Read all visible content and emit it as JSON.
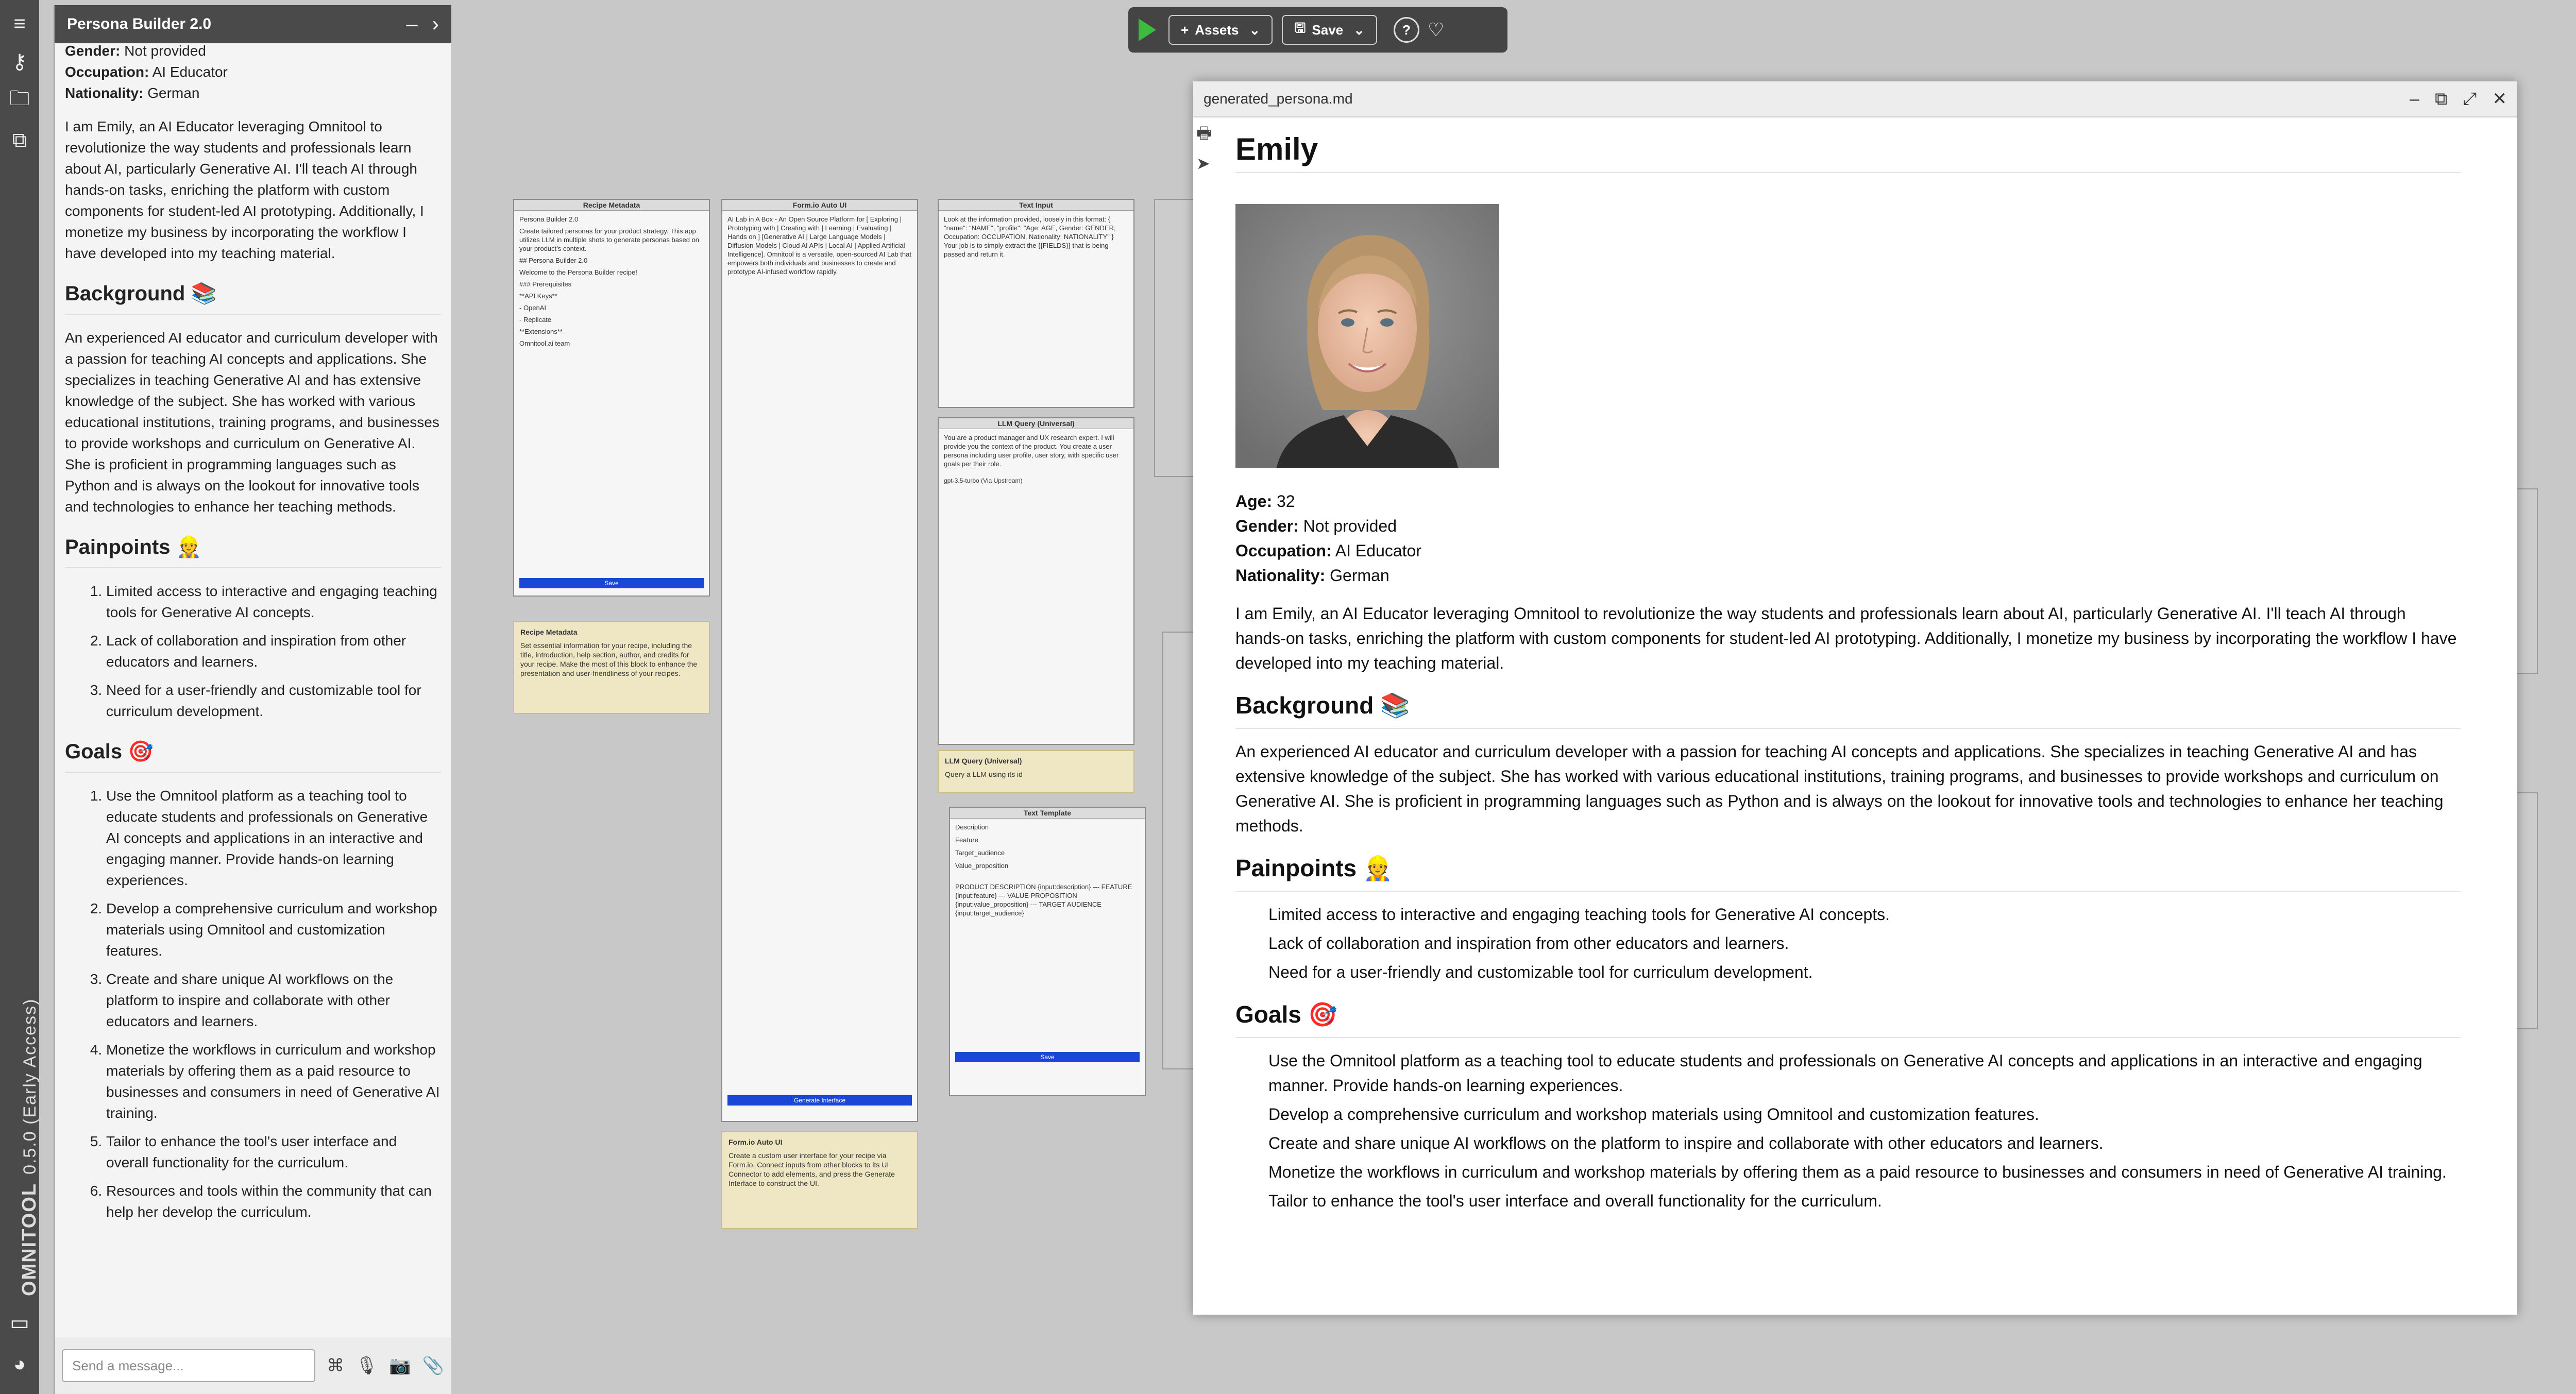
{
  "app": {
    "name": "OMNITOOL",
    "version": "0.5.0 (Early Access)"
  },
  "rail": {
    "icons": [
      "menu-icon",
      "key-icon",
      "folder-icon",
      "extensions-icon"
    ],
    "bottom_icons": [
      "chat-icon",
      "discord-icon"
    ]
  },
  "chat": {
    "title": "Persona Builder 2.0",
    "facts": [
      {
        "label": "Gender:",
        "value": "Not provided"
      },
      {
        "label": "Occupation:",
        "value": "AI Educator"
      },
      {
        "label": "Nationality:",
        "value": "German"
      }
    ],
    "intro": "I am Emily, an AI Educator leveraging Omnitool to revolutionize the way students and professionals learn about AI, particularly Generative AI. I'll teach AI through hands-on tasks, enriching the platform with custom components for student-led AI prototyping. Additionally, I monetize my business by incorporating the workflow I have developed into my teaching material.",
    "background_heading": "Background 📚",
    "background": "An experienced AI educator and curriculum developer with a passion for teaching AI concepts and applications. She specializes in teaching Generative AI and has extensive knowledge of the subject. She has worked with various educational institutions, training programs, and businesses to provide workshops and curriculum on Generative AI. She is proficient in programming languages such as Python and is always on the lookout for innovative tools and technologies to enhance her teaching methods.",
    "painpoints_heading": "Painpoints 👷",
    "painpoints": [
      "Limited access to interactive and engaging teaching tools for Generative AI concepts.",
      "Lack of collaboration and inspiration from other educators and learners.",
      "Need for a user-friendly and customizable tool for curriculum development."
    ],
    "goals_heading": "Goals 🎯",
    "goals": [
      "Use the Omnitool platform as a teaching tool to educate students and professionals on Generative AI concepts and applications in an interactive and engaging manner. Provide hands-on learning experiences.",
      "Develop a comprehensive curriculum and workshop materials using Omnitool and customization features.",
      "Create and share unique AI workflows on the platform to inspire and collaborate with other educators and learners.",
      "Monetize the workflows in curriculum and workshop materials by offering them as a paid resource to businesses and consumers in need of Generative AI training.",
      "Tailor to enhance the tool's user interface and overall functionality for the curriculum.",
      "Resources and tools within the community that can help her develop the curriculum."
    ],
    "input_placeholder": "Send a message..."
  },
  "toolbar": {
    "assets_label": "Assets",
    "save_label": "Save",
    "help": "?",
    "favorite": "♡"
  },
  "nodes": {
    "recipe_metadata": {
      "title": "Recipe Metadata",
      "lines": [
        "Persona Builder 2.0",
        "Create tailored personas for your product strategy. This app utilizes LLM in multiple shots to generate personas based on your product's context.",
        "## Persona Builder 2.0",
        "Welcome to the Persona Builder recipe!",
        "### Prerequisites",
        "**API Keys**",
        "- OpenAI",
        "- Replicate",
        "**Extensions**",
        "Omnitool.ai team"
      ],
      "save": "Save"
    },
    "recipe_note": {
      "title": "Recipe Metadata",
      "text": "Set essential information for your recipe, including the title, introduction, help section, author, and credits for your recipe. Make the most of this block to enhance the presentation and user-friendliness of your recipes."
    },
    "form_auto_ui": {
      "title": "Form.io Auto UI",
      "text": "AI Lab in A Box - An Open Source Platform for [ Exploring | Prototyping with | Creating with | Learning | Evaluating | Hands on ] [Generative AI | Large Language Models | Diffusion Models | Cloud AI APIs | Local AI | Applied Artificial Intelligence]. Omnitool is a versatile, open-sourced AI Lab that empowers both individuals and businesses to create and prototype AI-infused workflow rapidly.",
      "button": "Generate Interface"
    },
    "form_note": {
      "title": "Form.io Auto UI",
      "text": "Create a custom user interface for your recipe via Form.io. Connect inputs from other blocks to its UI Connector to add elements, and press the Generate Interface to construct the UI."
    },
    "text_input": {
      "title": "Text Input",
      "text": "Look at the information provided, loosely in this format: { \"name\": \"NAME\", \"profile\": \"Age: AGE, Gender: GENDER, Occupation: OCCUPATION, Nationality: NATIONALITY\" } Your job is to simply extract the {{FIELDS}} that is being passed and return it."
    },
    "llm_query": {
      "title": "LLM Query (Universal)",
      "text": "You are a product manager and UX research expert. I will provide you the context of the product. You create a user persona including user profile, user story, with specific user goals per their role.",
      "model": "gpt-3.5-turbo (Via Upstream)"
    },
    "llm_note": {
      "title": "LLM Query (Universal)",
      "text": "Query a LLM using its id"
    },
    "text_template": {
      "title": "Text Template",
      "fields": [
        "Description",
        "Feature",
        "Target_audience",
        "Value_proposition"
      ],
      "template": "PRODUCT DESCRIPTION {input:description} --- FEATURE {input:feature} --- VALUE PROPOSITION {input:value_proposition} --- TARGET AUDIENCE {input:target_audience}",
      "save": "Save"
    }
  },
  "document": {
    "filename": "generated_persona.md",
    "title": "Emily",
    "facts": [
      {
        "label": "Age:",
        "value": "32"
      },
      {
        "label": "Gender:",
        "value": "Not provided"
      },
      {
        "label": "Occupation:",
        "value": "AI Educator"
      },
      {
        "label": "Nationality:",
        "value": "German"
      }
    ],
    "intro": "I am Emily, an AI Educator leveraging Omnitool to revolutionize the way students and professionals learn about AI, particularly Generative AI. I'll teach AI through hands-on tasks, enriching the platform with custom components for student-led AI prototyping. Additionally, I monetize my business by incorporating the workflow I have developed into my teaching material.",
    "background_heading": "Background 📚",
    "background": "An experienced AI educator and curriculum developer with a passion for teaching AI concepts and applications. She specializes in teaching Generative AI and has extensive knowledge of the subject. She has worked with various educational institutions, training programs, and businesses to provide workshops and curriculum on Generative AI. She is proficient in programming languages such as Python and is always on the lookout for innovative tools and technologies to enhance her teaching methods.",
    "painpoints_heading": "Painpoints 👷",
    "painpoints": [
      "Limited access to interactive and engaging teaching tools for Generative AI concepts.",
      "Lack of collaboration and inspiration from other educators and learners.",
      "Need for a user-friendly and customizable tool for curriculum development."
    ],
    "goals_heading": "Goals 🎯",
    "goals": [
      "Use the Omnitool platform as a teaching tool to educate students and professionals on Generative AI concepts and applications in an interactive and engaging manner. Provide hands-on learning experiences.",
      "Develop a comprehensive curriculum and workshop materials using Omnitool and customization features.",
      "Create and share unique AI workflows on the platform to inspire and collaborate with other educators and learners.",
      "Monetize the workflows in curriculum and workshop materials by offering them as a paid resource to businesses and consumers in need of Generative AI training.",
      "Tailor to enhance the tool's user interface and overall functionality for the curriculum."
    ]
  },
  "colors": {
    "rail": "#4a4a4a",
    "play": "#3dbb3d",
    "note": "#efe7c4",
    "accent_button": "#1a47d6"
  }
}
